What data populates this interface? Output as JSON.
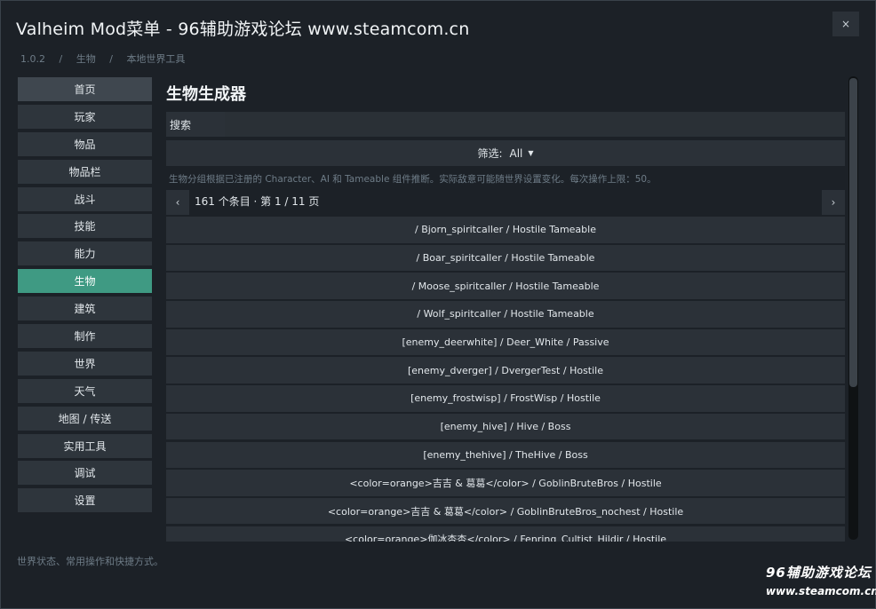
{
  "window": {
    "title": "Valheim Mod菜单 - 96辅助游戏论坛 www.steamcom.cn",
    "close_label": "×"
  },
  "breadcrumb": {
    "version": "1.0.2",
    "section": "生物",
    "page": "本地世界工具",
    "separator": "/"
  },
  "sidebar": {
    "items": [
      {
        "label": "首页"
      },
      {
        "label": "玩家"
      },
      {
        "label": "物品"
      },
      {
        "label": "物品栏"
      },
      {
        "label": "战斗"
      },
      {
        "label": "技能"
      },
      {
        "label": "能力"
      },
      {
        "label": "生物",
        "active": true
      },
      {
        "label": "建筑"
      },
      {
        "label": "制作"
      },
      {
        "label": "世界"
      },
      {
        "label": "天气"
      },
      {
        "label": "地图 / 传送"
      },
      {
        "label": "实用工具"
      },
      {
        "label": "调试"
      },
      {
        "label": "设置"
      }
    ],
    "footer_hint": "世界状态、常用操作和快捷方式。"
  },
  "main": {
    "title": "生物生成器",
    "search": {
      "label": "搜索",
      "value": "",
      "placeholder": ""
    },
    "filter": {
      "label": "筛选:",
      "value": "All"
    },
    "info": "生物分组根据已注册的 Character、AI 和 Tameable 组件推断。实际敌意可能随世界设置变化。每次操作上限：50。",
    "pager": {
      "prev": "‹",
      "next": "›",
      "summary": "161 个条目 · 第 1 / 11 页"
    },
    "rows": [
      "/ Bjorn_spiritcaller / Hostile Tameable",
      "/ Boar_spiritcaller / Hostile Tameable",
      "/ Moose_spiritcaller / Hostile Tameable",
      "/ Wolf_spiritcaller / Hostile Tameable",
      "[enemy_deerwhite] / Deer_White / Passive",
      "[enemy_dverger] / DvergerTest / Hostile",
      "[enemy_frostwisp] / FrostWisp / Hostile",
      "[enemy_hive] / Hive / Boss",
      "[enemy_thehive] / TheHive / Boss",
      "<color=orange>吉吉 & 葛葛</color> / GoblinBruteBros / Hostile",
      "<color=orange>吉吉 & 葛葛</color> / GoblinBruteBros_nochest / Hostile",
      "<color=orange>伽冰杏杏</color> / Fenring_Cultist_Hildir / Hostile"
    ]
  },
  "watermark": {
    "line1": "96辅助游戏论坛",
    "line2": "www.steamcom.cn"
  },
  "colors": {
    "accent": "#3f9a83",
    "background": "#1c2127",
    "panel": "#2b3138"
  }
}
